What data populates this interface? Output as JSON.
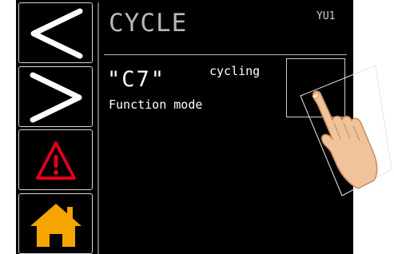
{
  "header": {
    "title": "CYCLE",
    "device_id": "YU1"
  },
  "nav": {
    "items": [
      {
        "icon": "chevron-left-icon"
      },
      {
        "icon": "chevron-right-icon"
      },
      {
        "icon": "warning-triangle-icon",
        "color": "#e0001a"
      },
      {
        "icon": "home-icon",
        "color": "#f5a500"
      }
    ]
  },
  "content": {
    "mode_code": "\"C7\"",
    "mode_state": "cycling",
    "mode_caption": "Function mode"
  },
  "overlay": {
    "icon": "pointing-hand-icon"
  }
}
